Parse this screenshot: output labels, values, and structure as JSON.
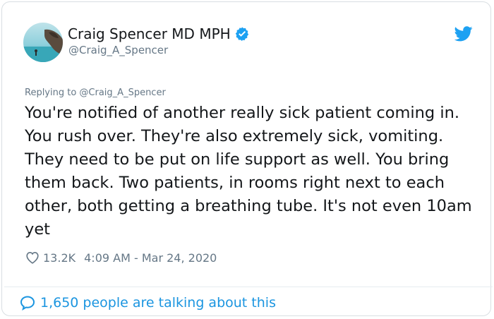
{
  "author": {
    "name": "Craig Spencer MD MPH",
    "handle": "@Craig_A_Spencer",
    "verified": true
  },
  "reply": {
    "text": "Replying to @Craig_A_Spencer"
  },
  "tweet": {
    "text": "You're notified of another really sick patient coming in. You rush over. They're also extremely sick, vomiting. They need to be put on life support as well. You bring them back. Two patients, in rooms right next to each other, both getting a breathing tube. It's not even 10am yet"
  },
  "meta": {
    "likes": "13.2K",
    "timestamp": "4:09 AM - Mar 24, 2020"
  },
  "footer": {
    "talking": "1,650 people are talking about this"
  },
  "colors": {
    "accent": "#1da1f2",
    "link": "#1b95e0",
    "muted": "#657786",
    "text": "#14171a"
  },
  "icons": {
    "verified": "verified-badge-icon",
    "brand": "twitter-bird-icon",
    "like": "heart-icon",
    "talking": "speech-bubble-icon"
  }
}
